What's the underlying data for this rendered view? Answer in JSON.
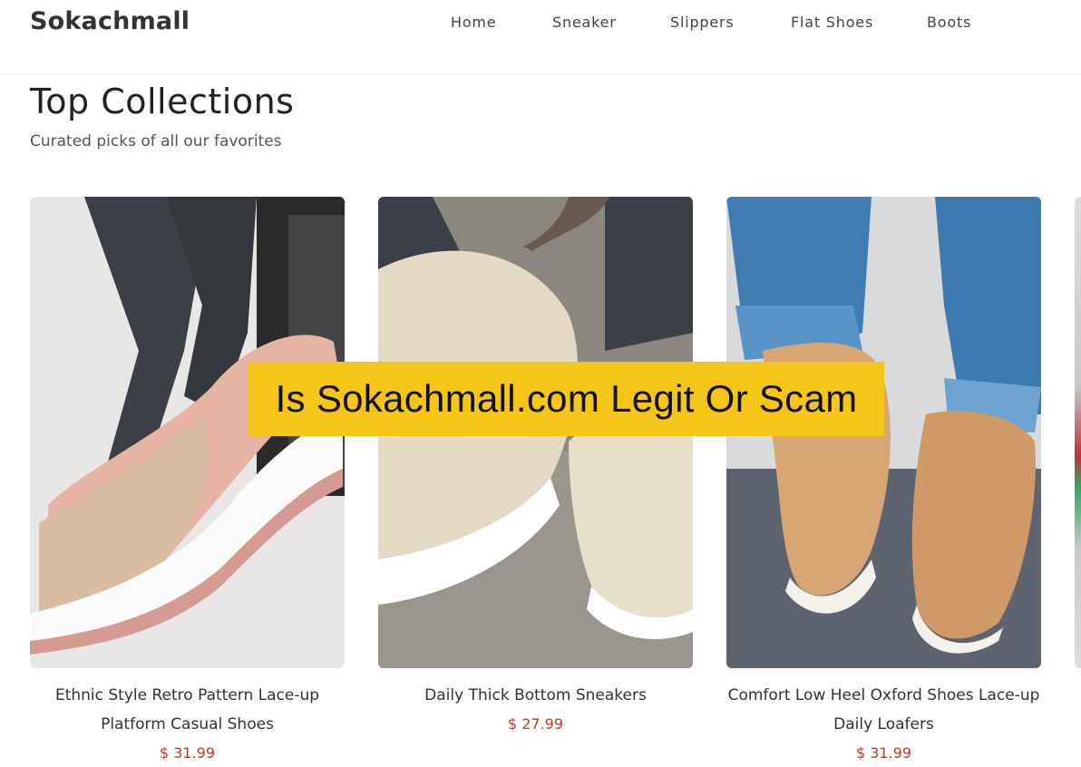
{
  "brand": "Sokachmall",
  "nav": [
    "Home",
    "Sneaker",
    "Slippers",
    "Flat Shoes",
    "Boots"
  ],
  "section": {
    "title": "Top Collections",
    "subtitle": "Curated picks of all our favorites"
  },
  "products": [
    {
      "name_line1": "Ethnic Style Retro Pattern Lace-up",
      "name_line2": "Platform Casual Shoes",
      "price": "$ 31.99"
    },
    {
      "name_line1": "Daily Thick Bottom Sneakers",
      "name_line2": "",
      "price": "$ 27.99"
    },
    {
      "name_line1": "Comfort Low Heel Oxford Shoes Lace-up",
      "name_line2": "Daily Loafers",
      "price": "$ 31.99"
    }
  ],
  "overlay_banner": "Is Sokachmall.com Legit Or Scam",
  "colors": {
    "price": "#c0392b",
    "banner": "#f5c518"
  }
}
